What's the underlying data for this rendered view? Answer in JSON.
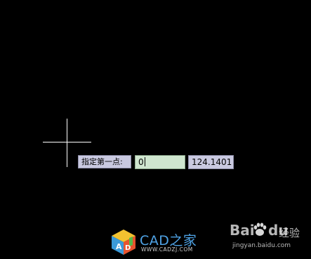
{
  "dynamic_input": {
    "prompt_label": "指定第一点:",
    "x_value": "0",
    "y_value": "124.1401"
  },
  "watermarks": {
    "cad_title": "CAD之家",
    "cad_url": "WWW.CADZJ.COM",
    "baidu_left": "Bai",
    "baidu_right": "du",
    "baidu_suffix": "经验",
    "baidu_url": "jingyan.baidu.com"
  },
  "colors": {
    "canvas": "#000000",
    "crosshair": "#ffffff",
    "prompt_bg": "#c9c9e0",
    "input_active_bg": "#cfe6cf",
    "cad_title": "#4fa3e6"
  },
  "icons": {
    "cursor": "crosshair-icon",
    "cad_logo": "cube-logo-icon",
    "baidu_logo": "paw-logo-icon"
  }
}
